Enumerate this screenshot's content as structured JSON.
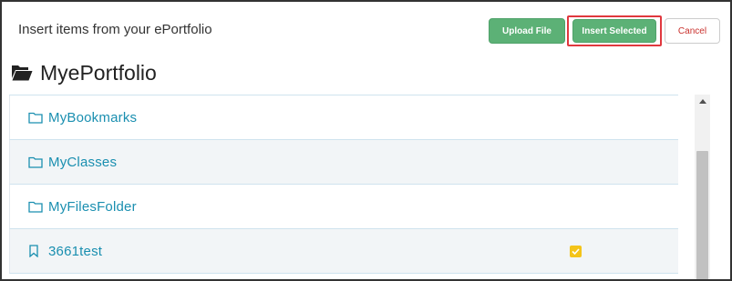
{
  "header": {
    "title": "Insert items from your ePortfolio"
  },
  "toolbar": {
    "upload_label": "Upload File",
    "insert_label": "Insert Selected",
    "cancel_label": "Cancel"
  },
  "portfolio": {
    "title": "MyePortfolio"
  },
  "items": [
    {
      "label": "MyBookmarks",
      "type": "folder",
      "checked": false
    },
    {
      "label": "MyClasses",
      "type": "folder",
      "checked": false
    },
    {
      "label": "MyFilesFolder",
      "type": "folder",
      "checked": false
    },
    {
      "label": "3661test",
      "type": "bookmark",
      "checked": true
    }
  ],
  "colors": {
    "accent_green": "#5cb176",
    "link_blue": "#1a8fb0",
    "highlight_red": "#e0383e",
    "checkbox_yellow": "#f4c419"
  }
}
